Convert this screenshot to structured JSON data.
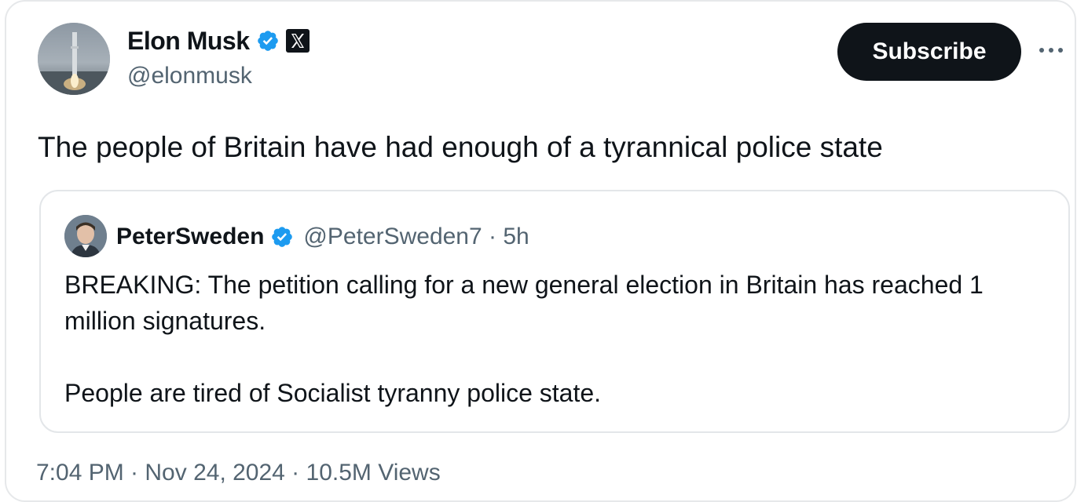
{
  "author": {
    "display_name": "Elon Musk",
    "handle": "@elonmusk",
    "verified_icon": "verified-badge-icon",
    "affiliation_icon": "x-logo-icon",
    "avatar": "profile-photo"
  },
  "actions": {
    "subscribe_label": "Subscribe",
    "more_icon": "more-horizontal-icon"
  },
  "tweet": {
    "text": "The people of Britain have had enough of a tyrannical police state"
  },
  "quoted_tweet": {
    "display_name": "PeterSweden",
    "handle_time": "@PeterSweden7 · 5h",
    "verified_icon": "verified-badge-icon",
    "avatar": "profile-photo",
    "paragraph_1": "BREAKING: The petition calling for a new general election in Britain has reached 1 million signatures.",
    "paragraph_2": "People are tired of Socialist tyranny police state."
  },
  "footer": {
    "timestamp": "7:04 PM · Nov 24, 2024 · 10.5M Views"
  },
  "colors": {
    "verified_blue": "#1d9bf0",
    "text_primary": "#0f1419",
    "text_secondary": "#536471",
    "border": "#e6e8ea"
  }
}
